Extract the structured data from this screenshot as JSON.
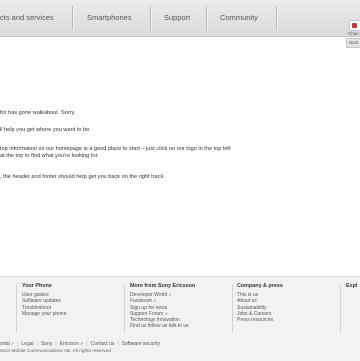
{
  "nav": {
    "items": [
      {
        "label": "cts and services"
      },
      {
        "label": "Smartphones"
      },
      {
        "label": "Support"
      },
      {
        "label": "Community"
      }
    ]
  },
  "message": {
    "line1": "for has gone walkabout. Sorry.",
    "line2": "ll help you get where you want to be.",
    "line3": "top information so our homepage is a good place to start – just click on our logo in the top left",
    "line4": "at the top to find what you're looking for.",
    "line5": ", the header and footer should help get you back on the right track."
  },
  "footer": {
    "columns": [
      {
        "heading": "Your Phone",
        "links": [
          "User guides",
          "Software updates",
          "Troubleshoot",
          "Manage your phone"
        ]
      },
      {
        "heading": "More from Sony Ericsson",
        "links": [
          "Developer World",
          "Facebook",
          "Sign up for news",
          "Support Forum",
          "Technology Innovation",
          "Find us follow us talk to us"
        ]
      },
      {
        "heading": "Company & press",
        "links": [
          "This is us",
          "About us",
          "Sustainability",
          "Jobs & Careers",
          "Press resources"
        ]
      }
    ],
    "explore": {
      "heading": "Expl",
      "sub": "Chan",
      "code": "GLO"
    },
    "legal": [
      "ortal",
      "Legal",
      "Sony",
      "Ericsson",
      "Contact us",
      "Software security"
    ],
    "copyright": "sson Mobile Communications AB. All rights reserved"
  }
}
